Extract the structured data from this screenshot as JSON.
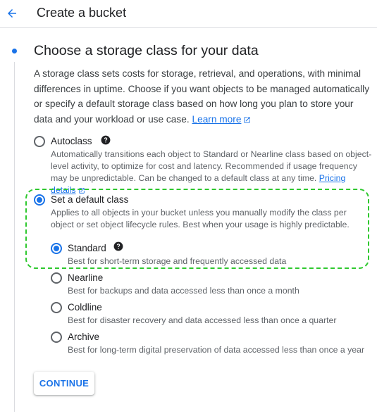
{
  "header": {
    "title": "Create a bucket",
    "back_icon": "arrow-back-icon"
  },
  "section": {
    "title": "Choose a storage class for your data",
    "description": "A storage class sets costs for storage, retrieval, and operations, with minimal differences in uptime. Choose if you want objects to be managed automatically or specify a default storage class based on how long you plan to store your data and your workload or use case.",
    "learn_more": "Learn more"
  },
  "options": {
    "autoclass": {
      "label": "Autoclass",
      "description": "Automatically transitions each object to Standard or Nearline class based on object-level activity, to optimize for cost and latency. Recommended if usage frequency may be unpredictable. Can be changed to a default class at any time.",
      "link": "Pricing details",
      "selected": false
    },
    "default_class": {
      "label": "Set a default class",
      "description": "Applies to all objects in your bucket unless you manually modify the class per object or set object lifecycle rules. Best when your usage is highly predictable.",
      "selected": true
    }
  },
  "classes": {
    "standard": {
      "label": "Standard",
      "description": "Best for short-term storage and frequently accessed data",
      "selected": true
    },
    "nearline": {
      "label": "Nearline",
      "description": "Best for backups and data accessed less than once a month",
      "selected": false
    },
    "coldline": {
      "label": "Coldline",
      "description": "Best for disaster recovery and data accessed less than once a quarter",
      "selected": false
    },
    "archive": {
      "label": "Archive",
      "description": "Best for long-term digital preservation of data accessed less than once a year",
      "selected": false
    }
  },
  "actions": {
    "continue_label": "CONTINUE"
  },
  "colors": {
    "accent": "#1a73e8",
    "highlight": "#2ec82e"
  }
}
